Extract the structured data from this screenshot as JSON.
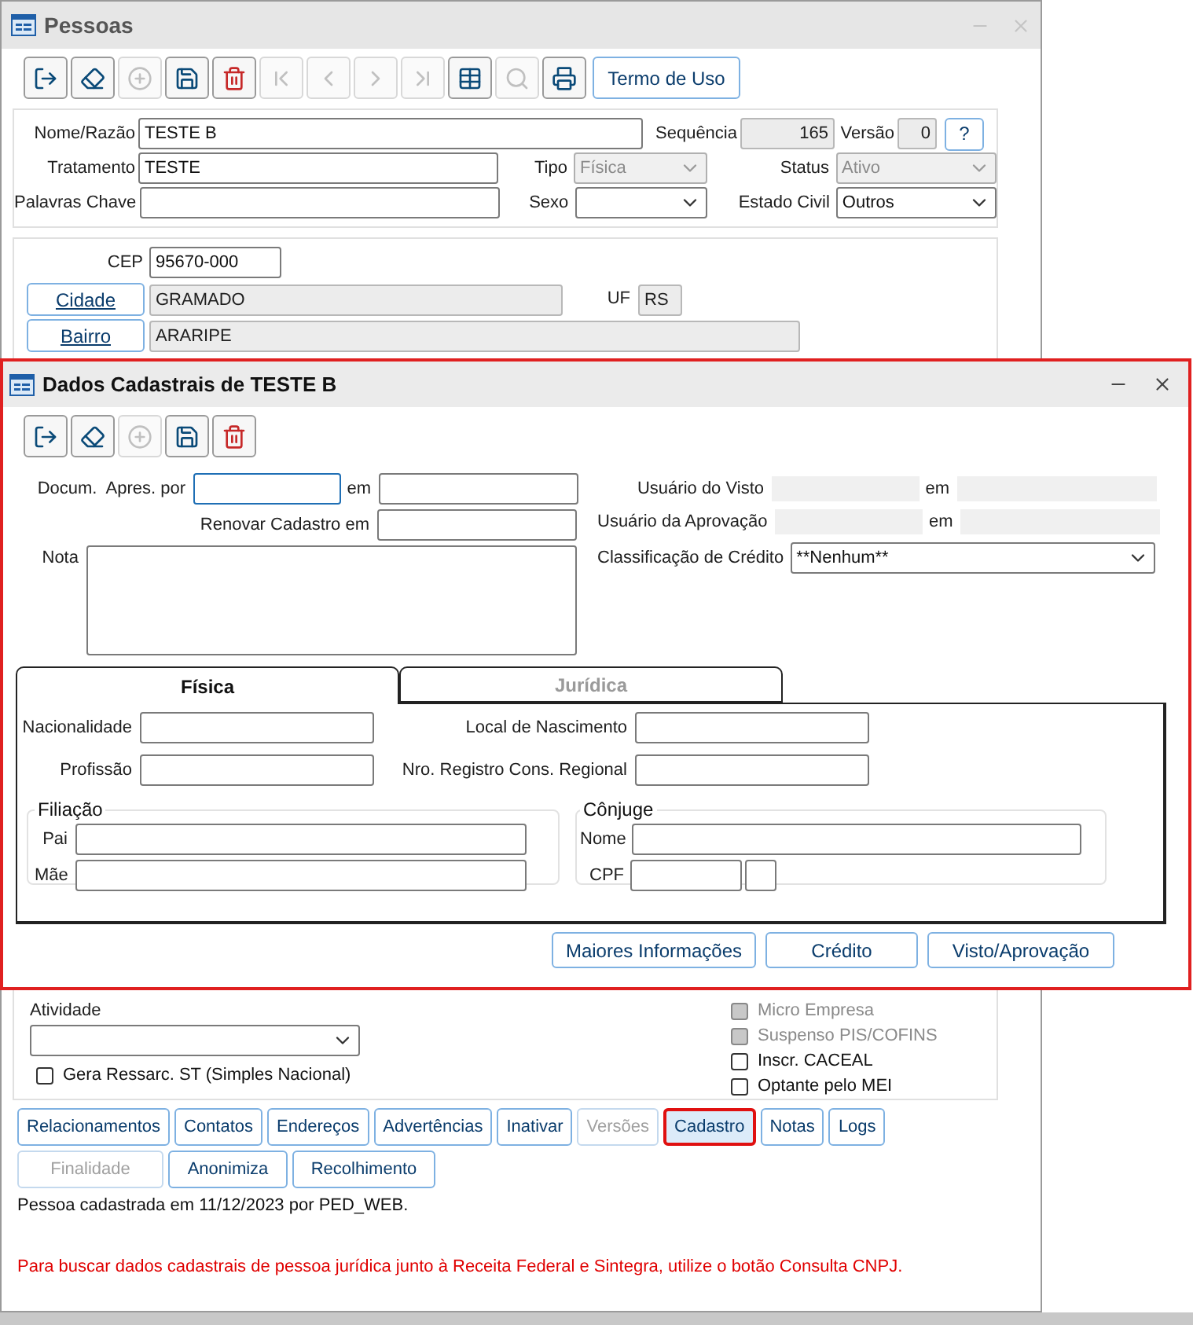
{
  "main_window": {
    "title": "Pessoas",
    "toolbar": [
      {
        "kind": "exit",
        "disabled": false
      },
      {
        "kind": "eraser",
        "disabled": false
      },
      {
        "kind": "add",
        "disabled": true
      },
      {
        "kind": "save",
        "disabled": false
      },
      {
        "kind": "delete",
        "disabled": false
      },
      {
        "kind": "first",
        "disabled": true
      },
      {
        "kind": "previous",
        "disabled": true
      },
      {
        "kind": "next",
        "disabled": true
      },
      {
        "kind": "last",
        "disabled": true
      },
      {
        "kind": "grid",
        "disabled": false
      },
      {
        "kind": "search",
        "disabled": true
      },
      {
        "kind": "print",
        "disabled": false
      }
    ],
    "termo_button": "Termo de Uso",
    "identity": {
      "nome": {
        "label": "Nome/Razão",
        "value": "TESTE B"
      },
      "sequencia": {
        "label": "Sequência",
        "value": "165"
      },
      "versao": {
        "label": "Versão",
        "value": "0"
      },
      "help_button": "?",
      "tratamento": {
        "label": "Tratamento",
        "value": "TESTE"
      },
      "tipo": {
        "label": "Tipo",
        "value": "Física",
        "disabled": true
      },
      "status": {
        "label": "Status",
        "value": "Ativo",
        "disabled": true
      },
      "palavras_chave": {
        "label": "Palavras Chave"
      },
      "sexo": {
        "label": "Sexo",
        "disabled": false
      },
      "estado_civil": {
        "label": "Estado Civil",
        "value": "Outros",
        "disabled": false
      }
    },
    "address": {
      "cep": {
        "label": "CEP",
        "value": "95670-000"
      },
      "cidade": {
        "button": "Cidade",
        "value": "GRAMADO"
      },
      "uf": {
        "label": "UF",
        "value": "RS"
      },
      "bairro": {
        "button": "Bairro",
        "value": "ARARIPE"
      }
    },
    "atividade": {
      "label": "Atividade"
    },
    "gera_ressarc": {
      "label": "Gera Ressarc. ST (Simples Nacional)",
      "checked": false
    },
    "flags": [
      {
        "label": "Micro Empresa",
        "checked": false,
        "disabled": true
      },
      {
        "label": "Suspenso PIS/COFINS",
        "checked": false,
        "disabled": true
      },
      {
        "label": "Inscr. CACEAL",
        "checked": false,
        "disabled": false
      },
      {
        "label": "Optante pelo MEI",
        "checked": false,
        "disabled": false
      }
    ],
    "buttons_row_1": [
      {
        "label": "Relacionamentos",
        "disabled": false,
        "selected": false
      },
      {
        "label": "Contatos",
        "disabled": false,
        "selected": false
      },
      {
        "label": "Endereços",
        "disabled": false,
        "selected": false
      },
      {
        "label": "Advertências",
        "disabled": false,
        "selected": false
      },
      {
        "label": "Inativar",
        "disabled": false,
        "selected": false
      },
      {
        "label": "Versões",
        "disabled": true,
        "selected": false
      },
      {
        "label": "Cadastro",
        "disabled": false,
        "selected": true
      },
      {
        "label": "Notas",
        "disabled": false,
        "selected": false
      },
      {
        "label": "Logs",
        "disabled": false,
        "selected": false
      }
    ],
    "buttons_row_2": [
      {
        "label": "Finalidade",
        "disabled": true,
        "selected": false
      },
      {
        "label": "Anonimiza",
        "disabled": false,
        "selected": false
      },
      {
        "label": "Recolhimento",
        "disabled": false,
        "selected": false
      }
    ],
    "status_text": "Pessoa cadastrada em 11/12/2023 por PED_WEB.",
    "notice": "Para buscar dados cadastrais de pessoa jurídica junto à Receita Federal e Sintegra, utilize o botão Consulta CNPJ."
  },
  "dialog": {
    "title": "Dados Cadastrais de TESTE B",
    "toolbar": [
      {
        "kind": "exit",
        "disabled": false
      },
      {
        "kind": "eraser",
        "disabled": false
      },
      {
        "kind": "add",
        "disabled": true
      },
      {
        "kind": "save",
        "disabled": false
      },
      {
        "kind": "delete",
        "disabled": false
      }
    ],
    "docum_label": "Docum.  Apres. por",
    "docum_em": "em",
    "renovar_label": "Renovar Cadastro em",
    "nota_label": "Nota",
    "usuario_visto": {
      "label": "Usuário do Visto",
      "em": "em"
    },
    "usuario_aprovacao": {
      "label": "Usuário da Aprovação",
      "em": "em"
    },
    "classificacao": {
      "label": "Classificação de Crédito",
      "value": "**Nenhum**"
    },
    "tabs": [
      {
        "label": "Física",
        "selected": true
      },
      {
        "label": "Jurídica",
        "selected": false
      }
    ],
    "fisica": {
      "nacionalidade": "Nacionalidade",
      "profissao": "Profissão",
      "local_nascimento": "Local de Nascimento",
      "registro": "Nro. Registro Cons. Regional",
      "filiacao": {
        "title": "Filiação",
        "pai": "Pai",
        "mae": "Mãe"
      },
      "conjuge": {
        "title": "Cônjuge",
        "nome": "Nome",
        "cpf": "CPF"
      }
    },
    "buttons": [
      "Maiores Informações",
      "Crédito",
      "Visto/Aprovação"
    ]
  }
}
